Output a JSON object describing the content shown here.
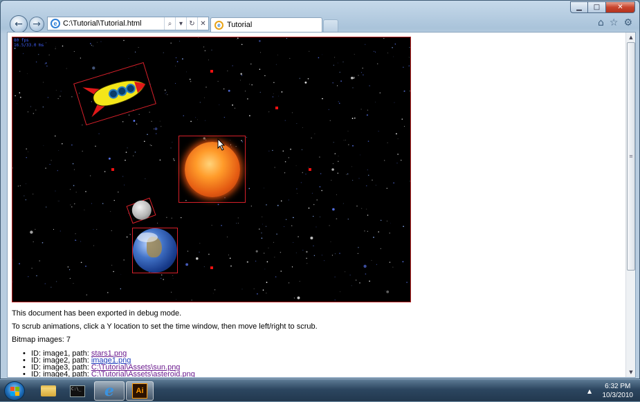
{
  "browser": {
    "address": "C:\\Tutorial\\Tutorial.html",
    "tab_title": "Tutorial",
    "addr_buttons": {
      "search": "⌕",
      "dropdown": "▾",
      "refresh": "↻",
      "stop": "✕"
    },
    "nav": {
      "back": "←",
      "forward": "→"
    },
    "icons": [
      "home-icon",
      "favorites-icon",
      "tools-icon"
    ]
  },
  "canvas": {
    "debug_lines": [
      "80 fps",
      "16.5/33.0 ms"
    ],
    "sprites": [
      "rocket",
      "sun",
      "moon",
      "earth"
    ]
  },
  "document": {
    "paragraph1": "This document has been exported in debug mode.",
    "paragraph2": "To scrub animations, click a Y location to set the time window, then move left/right to scrub.",
    "bitmap_count": "Bitmap images: 7",
    "images": [
      {
        "prefix": "ID: image1, path: ",
        "path": "stars1.png",
        "visited": true
      },
      {
        "prefix": "ID: image2, path: ",
        "path": "image1.png",
        "visited": false
      },
      {
        "prefix": "ID: image3, path: ",
        "path": "C:\\Tutorial\\Assets\\sun.png",
        "visited": true
      },
      {
        "prefix": "ID: image4, path: ",
        "path": "C:\\Tutorial\\Assets\\asteroid.png",
        "visited": true
      }
    ]
  },
  "taskbar": {
    "time": "6:32 PM",
    "date": "10/3/2010",
    "apps": [
      "windows-explorer",
      "command-prompt",
      "internet-explorer",
      "adobe-illustrator"
    ],
    "ai_label": "Ai",
    "cmd_label": "C:\\_"
  },
  "colors": {
    "accent": "#2f7fd6",
    "bounding_box": "#d8202a",
    "visited_link": "#6b1a8e"
  }
}
